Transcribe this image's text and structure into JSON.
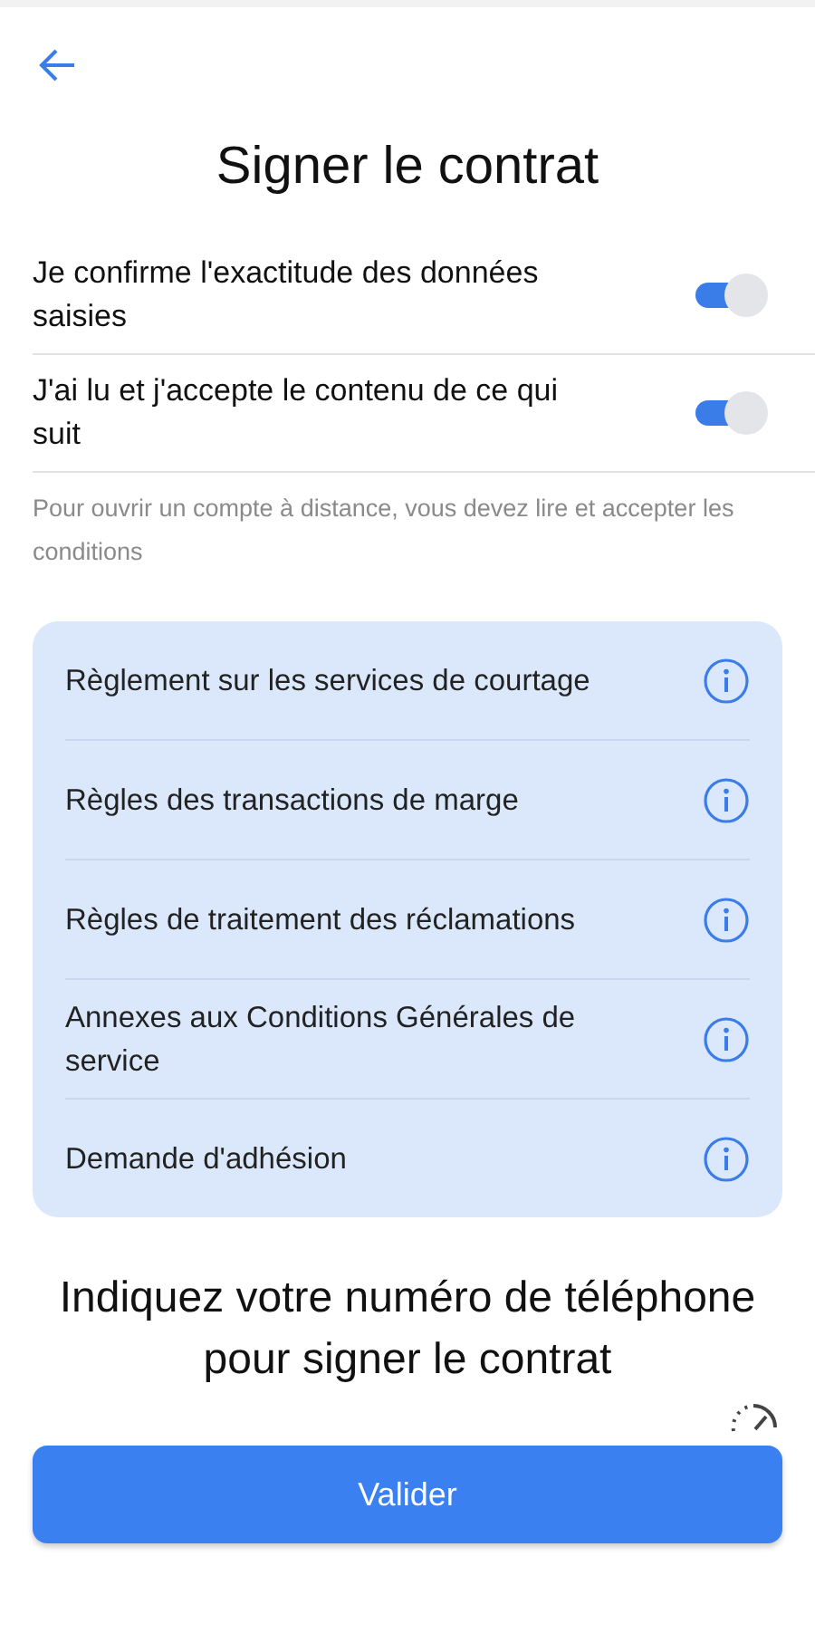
{
  "title": "Signer le contrat",
  "toggles": [
    {
      "label": "Je confirme l'exactitude des données saisies",
      "on": true
    },
    {
      "label": "J'ai lu et j'accepte le contenu de ce qui suit",
      "on": true
    }
  ],
  "note": "Pour ouvrir un compte à distance, vous devez lire et accepter les conditions",
  "documents": [
    {
      "label": "Règlement sur les services de courtage"
    },
    {
      "label": "Règles des transactions de marge"
    },
    {
      "label": "Règles de traitement des réclamations"
    },
    {
      "label": "Annexes aux Conditions Générales de service"
    },
    {
      "label": "Demande d'adhésion"
    }
  ],
  "phone_heading": "Indiquez votre numéro de téléphone pour signer le contrat",
  "submit": "Valider"
}
